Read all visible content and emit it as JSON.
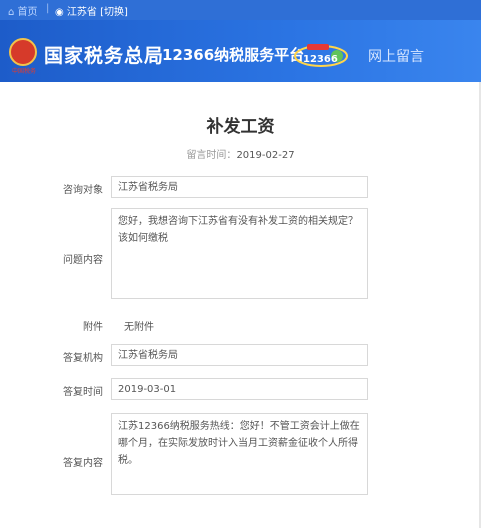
{
  "topbar": {
    "home_label": "首页",
    "location": "江苏省 [切换]"
  },
  "header": {
    "org_name": "国家税务总局",
    "platform_name": "12366纳税服务平台",
    "logo_text": "12366",
    "section": "网上留言",
    "emblem_caption": "中国税务"
  },
  "message": {
    "title": "补发工资",
    "date_label": "留言时间：",
    "date": "2019-02-27",
    "fields": {
      "target_label": "咨询对象",
      "target": "江苏省税务局",
      "question_label": "问题内容",
      "question": "您好，我想咨询下江苏省有没有补发工资的相关规定？该如何缴税",
      "attachment_label": "附件",
      "attachment": "无附件",
      "reply_org_label": "答复机构",
      "reply_org": "江苏省税务局",
      "reply_time_label": "答复时间",
      "reply_time": "2019-03-01",
      "reply_content_label": "答复内容",
      "reply_content": "江苏12366纳税服务热线：您好！不管工资会计上做在哪个月，在实际发放时计入当月工资薪金征收个人所得税。"
    }
  },
  "colors": {
    "topbar": "#2f6fd6",
    "header_start": "#1d5cc9",
    "header_end": "#3a85ee",
    "emblem": "#d63a2a"
  }
}
